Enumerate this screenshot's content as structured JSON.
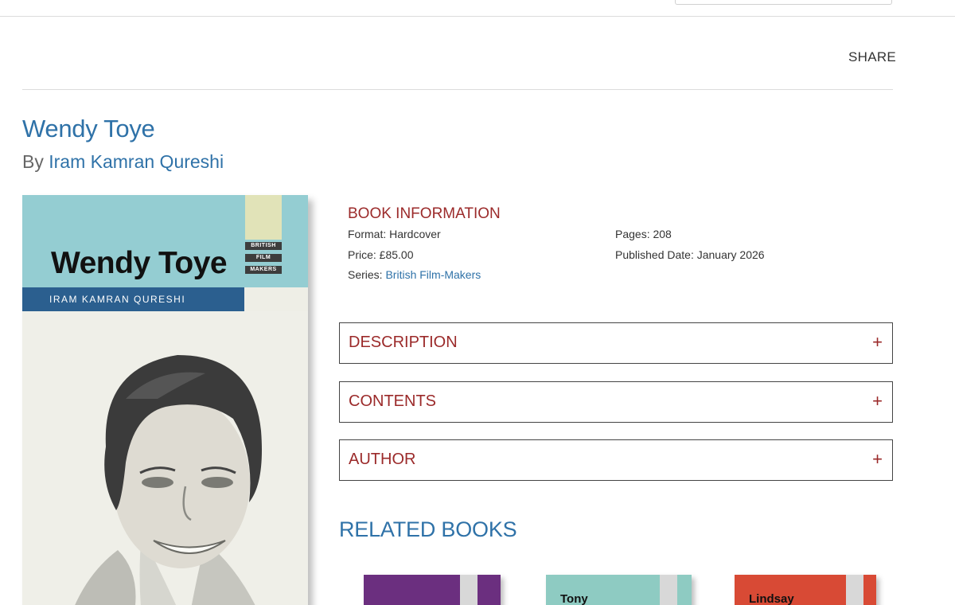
{
  "header": {
    "share_label": "SHARE"
  },
  "book": {
    "title": "Wendy Toye",
    "by_prefix": "By",
    "author": "Iram Kamran Qureshi"
  },
  "cover": {
    "title": "Wendy Toye",
    "author": "Iram Kamran Qureshi",
    "series_lines": [
      "BRITISH",
      "FILM",
      "MAKERS"
    ]
  },
  "info": {
    "heading": "BOOK INFORMATION",
    "format": "Format: Hardcover",
    "price": "Price: £85.00",
    "series_label": "Series:",
    "series_link": "British Film-Makers",
    "pages": "Pages: 208",
    "published": "Published Date: January 2026"
  },
  "accordions": [
    {
      "label": "DESCRIPTION",
      "icon": "+"
    },
    {
      "label": "CONTENTS",
      "icon": "+"
    },
    {
      "label": "AUTHOR",
      "icon": "+"
    }
  ],
  "related": {
    "heading": "RELATED BOOKS",
    "books": [
      {
        "title": "",
        "color": "#6b2f7f"
      },
      {
        "title": "Tony",
        "color": "#8ecbc2"
      },
      {
        "title": "Lindsay",
        "color": "#d84a35"
      }
    ]
  },
  "colors": {
    "link_blue": "#2f72a8",
    "accent_red": "#9b2a2a"
  }
}
